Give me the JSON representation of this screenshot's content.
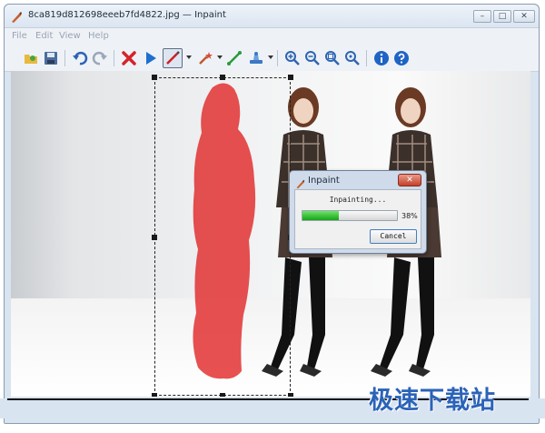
{
  "window": {
    "title": "8ca819d812698eeeb7fd4822.jpg — Inpaint",
    "controls": {
      "minimize": "–",
      "maximize": "□",
      "close": "✕"
    }
  },
  "menu": {
    "items": [
      "File",
      "Edit",
      "View",
      "Help"
    ]
  },
  "toolbar": {
    "buttons": [
      "open-icon",
      "save-icon",
      "undo-icon",
      "redo-icon",
      "erase-icon",
      "run-icon",
      "marker-icon",
      "magic-wand-icon",
      "line-icon",
      "stamp-icon",
      "zoom-in-icon",
      "zoom-out-icon",
      "zoom-fit-icon",
      "zoom-actual-icon",
      "info-icon",
      "help-icon"
    ],
    "active_tool": "marker-icon"
  },
  "dialog": {
    "title": "Inpaint",
    "status": "Inpainting...",
    "progress": 38,
    "progress_label": "38%",
    "cancel_label": "Cancel"
  },
  "watermark": "极速下载站",
  "colors": {
    "mask": "#e02020",
    "progress": "#22b322",
    "accent": "#2b63b8"
  }
}
